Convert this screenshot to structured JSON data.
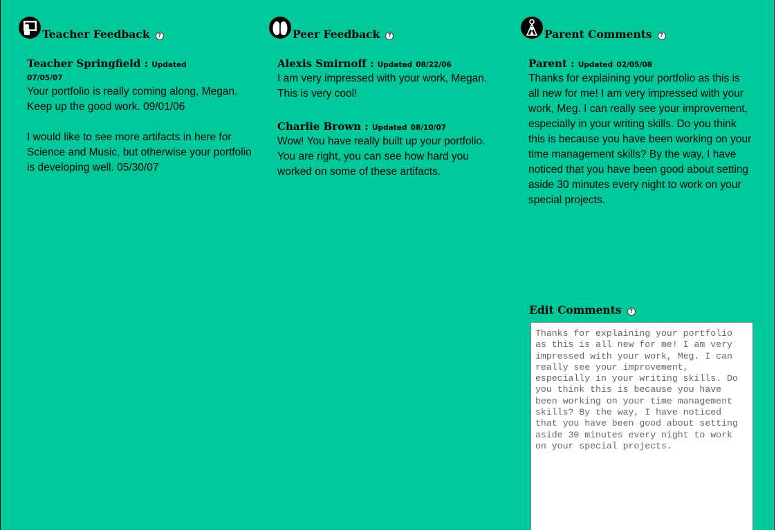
{
  "teacher": {
    "title": "Teacher Feedback",
    "entries": [
      {
        "author": "Teacher Springfield :",
        "updated_label": "Updated",
        "updated_date": "07/05/07",
        "paragraphs": [
          "Your portfolio is really coming along, Megan. Keep up the good work. 09/01/06",
          "I would like to see more artifacts in here for Science and Music, but otherwise your portfolio is developing well. 05/30/07"
        ]
      }
    ]
  },
  "peer": {
    "title": "Peer Feedback",
    "entries": [
      {
        "author": "Alexis Smirnoff :",
        "updated_label": "Updated",
        "updated_date": "08/22/06",
        "body": "I am very impressed with your work, Megan. This is very cool!"
      },
      {
        "author": "Charlie Brown :",
        "updated_label": "Updated",
        "updated_date": "08/10/07",
        "body": "Wow! You have really built up your portfolio. You are right, you can see how hard you worked on some of these artifacts."
      }
    ]
  },
  "parent": {
    "title": "Parent Comments",
    "entries": [
      {
        "author": "Parent :",
        "updated_label": "Updated",
        "updated_date": "02/05/08",
        "body": "Thanks for explaining your portfolio as this is all new for me! I am very impressed with your work, Meg. I can really see your improvement, especially in your writing skills. Do you think this is because you have been working on your time management skills? By the way, I have noticed that you have been good about setting aside 30 minutes every night to work on your special projects."
      }
    ],
    "edit": {
      "title": "Edit Comments",
      "text": "Thanks for explaining your portfolio as this is all new for me! I am very impressed with your work, Meg. I can really see your improvement, especially in your writing skills. Do you think this is because you have been working on your time management skills?  By the way, I have noticed that you have been good about setting aside 30 minutes every night to work on your special projects."
    }
  },
  "help_icon_glyph": "?",
  "colors": {
    "background": "#00c99b",
    "text": "#000000",
    "textarea_text": "#666666"
  },
  "icons": {
    "teacher": "teacher-presentation-icon",
    "peer": "peer-group-icon",
    "parent": "parent-child-icon",
    "help": "help-icon"
  }
}
